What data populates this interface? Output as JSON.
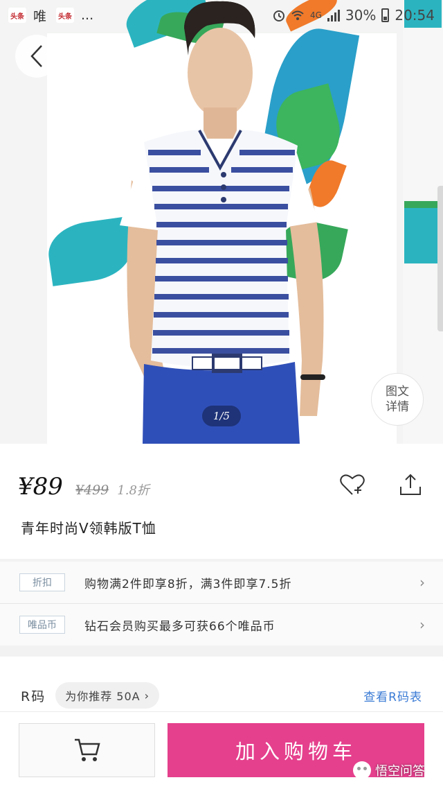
{
  "status_bar": {
    "app_badge_1": "头条",
    "app_name": "唯",
    "app_badge_2": "头条",
    "ellipsis": "...",
    "network": "4G",
    "battery": "30%",
    "time": "20:54"
  },
  "hero": {
    "page_indicator": "1/5",
    "detail_button_line1": "图文",
    "detail_button_line2": "详情"
  },
  "product": {
    "price": "¥89",
    "original_price": "¥499",
    "discount": "1.8折",
    "title": "青年时尚V领韩版T恤"
  },
  "promotions": [
    {
      "tag": "折扣",
      "text": "购物满2件即享8折，满3件即享7.5折"
    },
    {
      "tag": "唯品币",
      "text": "钻石会员购买最多可获66个唯品币"
    }
  ],
  "size": {
    "label": "R码",
    "recommendation": "为你推荐 50A",
    "size_chart_link": "查看R码表"
  },
  "bottom_bar": {
    "add_to_cart": "加入购物车"
  },
  "watermark": "悟空问答",
  "colors": {
    "accent": "#e5408d",
    "link": "#3a7bd5",
    "shirt_stripe": "#3b4fa0",
    "pants": "#2f4fb8",
    "leaf_teal": "#2bb4c0",
    "leaf_orange": "#f07a2a",
    "leaf_green": "#37a85a"
  }
}
